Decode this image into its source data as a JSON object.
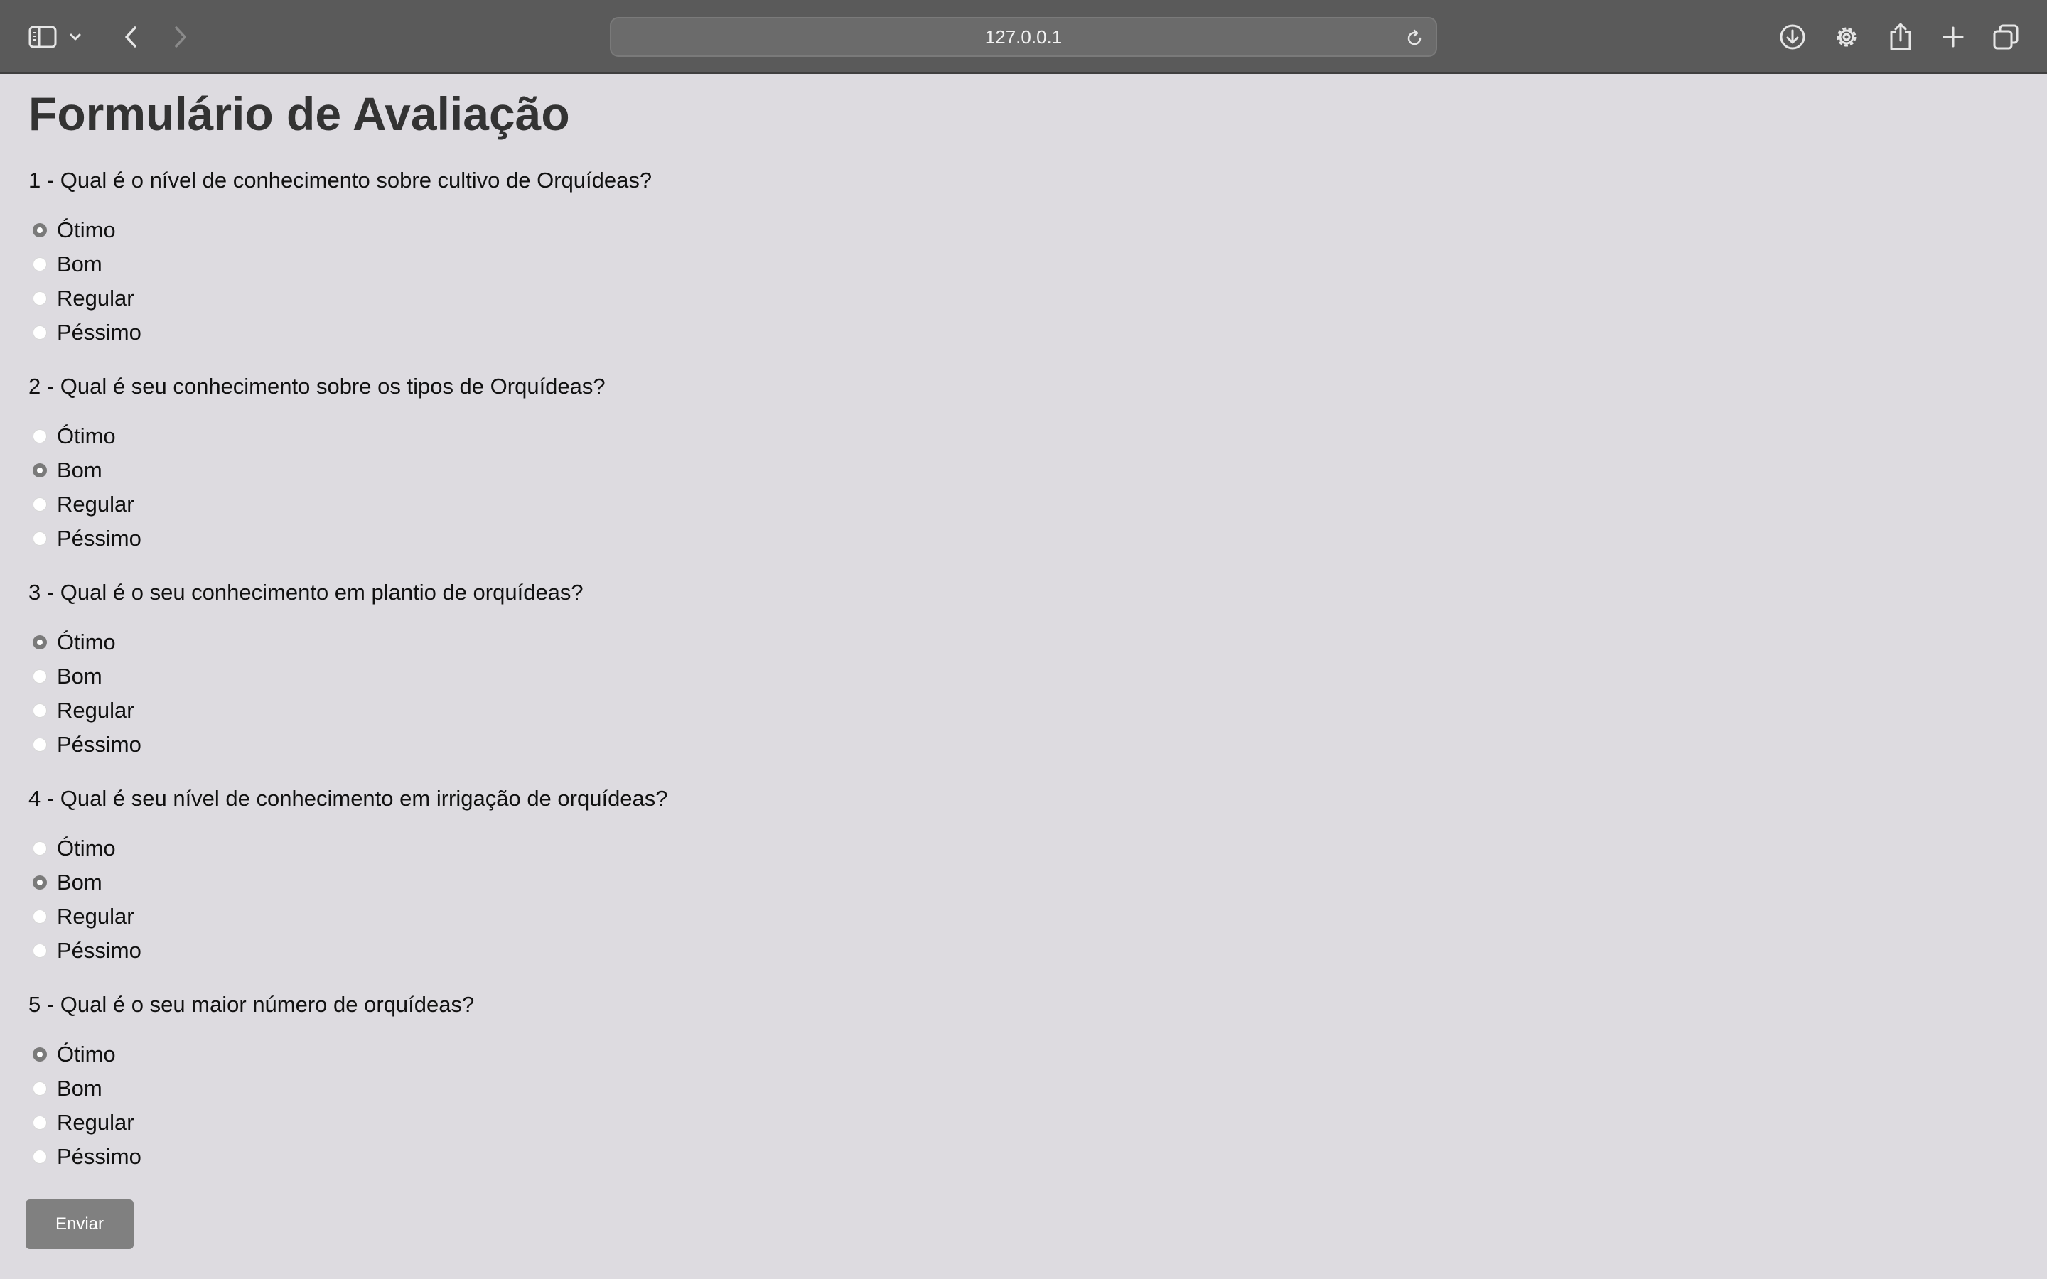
{
  "browser": {
    "url": "127.0.0.1",
    "icons": [
      "sidebar-icon",
      "chevron-down-icon",
      "back-icon",
      "forward-icon",
      "reload-icon",
      "download-icon",
      "gear-icon",
      "share-icon",
      "plus-icon",
      "tabs-icon"
    ]
  },
  "form": {
    "title": "Formulário de Avaliação",
    "questions": [
      {
        "label": "1 - Qual é o nível de conhecimento sobre cultivo de Orquídeas?",
        "options": [
          "Ótimo",
          "Bom",
          "Regular",
          "Péssimo"
        ],
        "selected": "Ótimo"
      },
      {
        "label": "2 - Qual é seu conhecimento sobre os tipos de Orquídeas?",
        "options": [
          "Ótimo",
          "Bom",
          "Regular",
          "Péssimo"
        ],
        "selected": "Bom"
      },
      {
        "label": "3 - Qual é o seu conhecimento em plantio de orquídeas?",
        "options": [
          "Ótimo",
          "Bom",
          "Regular",
          "Péssimo"
        ],
        "selected": "Ótimo"
      },
      {
        "label": "4 - Qual é seu nível de conhecimento em irrigação de orquídeas?",
        "options": [
          "Ótimo",
          "Bom",
          "Regular",
          "Péssimo"
        ],
        "selected": "Bom"
      },
      {
        "label": "5 - Qual é o seu maior número de orquídeas?",
        "options": [
          "Ótimo",
          "Bom",
          "Regular",
          "Péssimo"
        ],
        "selected": "Ótimo"
      }
    ],
    "submit_label": "Enviar"
  }
}
